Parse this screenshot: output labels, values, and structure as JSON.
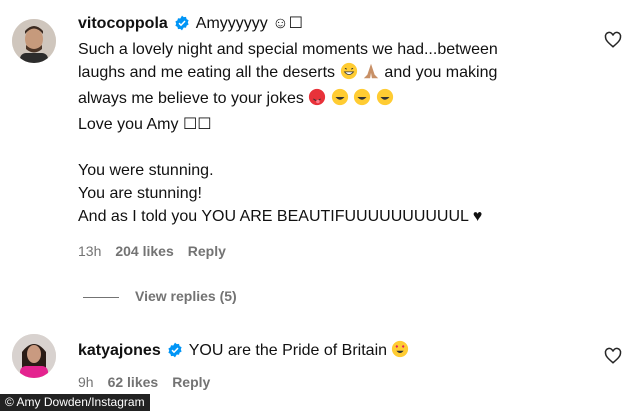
{
  "comments": [
    {
      "username": "vitocoppola",
      "first_line": "Amyyyyyy ☺☐",
      "lines": [
        "Such a lovely night and special moments we had...between",
        "laughs and me eating all the deserts",
        "always me believe to your jokes",
        "Love you Amy ☐☐",
        "",
        "You were stunning.",
        "You are stunning!",
        "And as I told you YOU ARE BEAUTIFUUUUUUUUUUL ♥"
      ],
      "line2_suffix": "and you making",
      "time": "13h",
      "likes": "204 likes",
      "reply": "Reply",
      "view_replies": "View replies (5)"
    },
    {
      "username": "katyajones",
      "text": "YOU are the Pride of Britain",
      "time": "9h",
      "likes": "62 likes",
      "reply": "Reply"
    }
  ],
  "credit": "© Amy Dowden/Instagram",
  "colors": {
    "verified": "#0095f6",
    "meta": "#737373"
  }
}
